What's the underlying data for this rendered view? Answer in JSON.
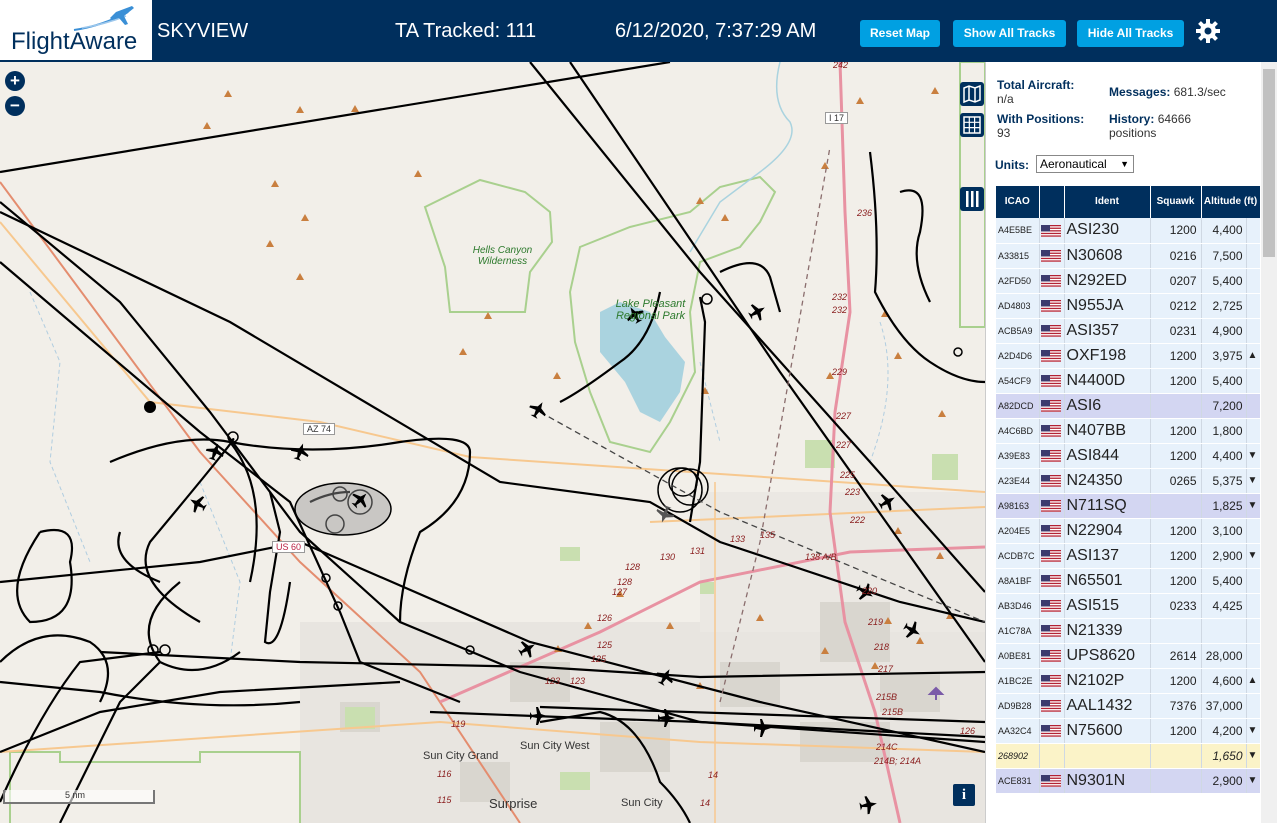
{
  "header": {
    "logo_text": "FlightAware",
    "app_title": "SKYVIEW",
    "tracked": "TA Tracked: 111",
    "clock": "6/12/2020, 7:37:29 AM",
    "buttons": {
      "reset": "Reset Map",
      "show_all": "Show All Tracks",
      "hide_all": "Hide All Tracks"
    },
    "settings_icon": "gear-icon"
  },
  "map": {
    "zoom_in": "+",
    "zoom_out": "−",
    "scale_label": "5 nm",
    "info_label": "i",
    "labels": {
      "hells_canyon": "Hells Canyon Wilderness",
      "lake_pleasant": "Lake Pleasant Regional Park",
      "sun_city_grand": "Sun City Grand",
      "sun_city_west": "Sun City West",
      "sun_city": "Sun City",
      "surprise": "Surprise",
      "az74": "AZ 74",
      "us60": "US 60",
      "i17": "I 17"
    },
    "mileposts": [
      "242",
      "236",
      "232",
      "232",
      "229",
      "227",
      "227",
      "225",
      "223",
      "222",
      "220",
      "219",
      "218",
      "217",
      "215B",
      "215B",
      "214C",
      "214B; 214A",
      "14",
      "14",
      "119",
      "116",
      "115",
      "123",
      "125",
      "125",
      "126",
      "127",
      "128",
      "128",
      "130",
      "131",
      "133",
      "135",
      "138 A/B",
      "123",
      "126"
    ]
  },
  "panel": {
    "total_aircraft_label": "Total Aircraft:",
    "total_aircraft_value": "n/a",
    "with_positions_label": "With Positions:",
    "with_positions_value": "93",
    "messages_label": "Messages:",
    "messages_value": "681.3/sec",
    "history_label": "History:",
    "history_value": "64666 positions",
    "units_label": "Units:",
    "units_value": "Aeronautical",
    "columns": [
      "ICAO",
      "Ident",
      "Squawk",
      "Altitude (ft)"
    ],
    "rows": [
      {
        "icao": "A4E5BE",
        "ident": "ASI230",
        "squawk": "1200",
        "alt": "4,400",
        "trend": "",
        "style": ""
      },
      {
        "icao": "A33815",
        "ident": "N30608",
        "squawk": "0216",
        "alt": "7,500",
        "trend": "",
        "style": ""
      },
      {
        "icao": "A2FD50",
        "ident": "N292ED",
        "squawk": "0207",
        "alt": "5,400",
        "trend": "",
        "style": ""
      },
      {
        "icao": "AD4803",
        "ident": "N955JA",
        "squawk": "0212",
        "alt": "2,725",
        "trend": "",
        "style": ""
      },
      {
        "icao": "ACB5A9",
        "ident": "ASI357",
        "squawk": "0231",
        "alt": "4,900",
        "trend": "",
        "style": ""
      },
      {
        "icao": "A2D4D6",
        "ident": "OXF198",
        "squawk": "1200",
        "alt": "3,975",
        "trend": "▲",
        "style": ""
      },
      {
        "icao": "A54CF9",
        "ident": "N4400D",
        "squawk": "1200",
        "alt": "5,400",
        "trend": "",
        "style": ""
      },
      {
        "icao": "A82DCD",
        "ident": "ASI6",
        "squawk": "",
        "alt": "7,200",
        "trend": "",
        "style": "sel"
      },
      {
        "icao": "A4C6BD",
        "ident": "N407BB",
        "squawk": "1200",
        "alt": "1,800",
        "trend": "",
        "style": ""
      },
      {
        "icao": "A39E83",
        "ident": "ASI844",
        "squawk": "1200",
        "alt": "4,400",
        "trend": "▼",
        "style": ""
      },
      {
        "icao": "A23E44",
        "ident": "N24350",
        "squawk": "0265",
        "alt": "5,375",
        "trend": "▼",
        "style": ""
      },
      {
        "icao": "A98163",
        "ident": "N711SQ",
        "squawk": "",
        "alt": "1,825",
        "trend": "▼",
        "style": "sel"
      },
      {
        "icao": "A204E5",
        "ident": "N22904",
        "squawk": "1200",
        "alt": "3,100",
        "trend": "",
        "style": ""
      },
      {
        "icao": "ACDB7C",
        "ident": "ASI137",
        "squawk": "1200",
        "alt": "2,900",
        "trend": "▼",
        "style": ""
      },
      {
        "icao": "A8A1BF",
        "ident": "N65501",
        "squawk": "1200",
        "alt": "5,400",
        "trend": "",
        "style": ""
      },
      {
        "icao": "AB3D46",
        "ident": "ASI515",
        "squawk": "0233",
        "alt": "4,425",
        "trend": "",
        "style": ""
      },
      {
        "icao": "A1C78A",
        "ident": "N21339",
        "squawk": "",
        "alt": "",
        "trend": "",
        "style": ""
      },
      {
        "icao": "A0BE81",
        "ident": "UPS8620",
        "squawk": "2614",
        "alt": "28,000",
        "trend": "",
        "style": ""
      },
      {
        "icao": "A1BC2E",
        "ident": "N2102P",
        "squawk": "1200",
        "alt": "4,600",
        "trend": "▲",
        "style": ""
      },
      {
        "icao": "AD9B28",
        "ident": "AAL1432",
        "squawk": "7376",
        "alt": "37,000",
        "trend": "",
        "style": ""
      },
      {
        "icao": "AA32C4",
        "ident": "N75600",
        "squawk": "1200",
        "alt": "4,200",
        "trend": "▼",
        "style": ""
      },
      {
        "icao": "268902",
        "ident": "",
        "squawk": "",
        "alt": "1,650",
        "trend": "▼",
        "style": "nf"
      },
      {
        "icao": "ACE831",
        "ident": "N9301N",
        "squawk": "",
        "alt": "2,900",
        "trend": "▼",
        "style": "sel"
      }
    ]
  },
  "colors": {
    "header_bg": "#002f5d",
    "button_bg": "#00a0e2",
    "row_bg": "#e7f1fb",
    "row_selected_bg": "#d3d6f2",
    "row_noflag_bg": "#fbf3c8",
    "map_bg": "#f2efe9"
  }
}
